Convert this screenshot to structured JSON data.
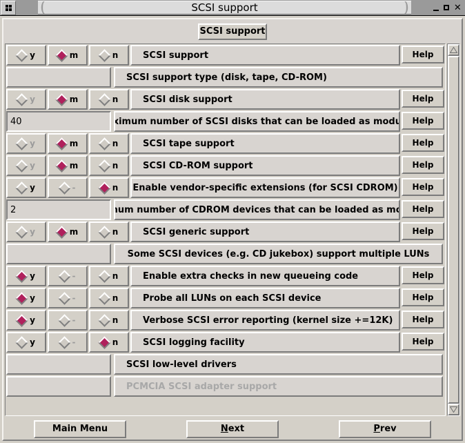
{
  "window": {
    "title": "SCSI support",
    "menu_icon": "window-menu-icon",
    "minimize_label": "minimize-icon",
    "maximize_label": "maximize-icon",
    "close_label": "close-icon"
  },
  "header": {
    "page_button": "SCSI support"
  },
  "colors": {
    "face": "#d4d0c8",
    "selected_radio": "#a01050",
    "disabled_text": "#a8a8a8"
  },
  "help_label": "Help",
  "radio_options": {
    "yes": "y",
    "module": "m",
    "no": "n",
    "na": "-"
  },
  "rows": [
    {
      "type": "radio",
      "y": "y",
      "m": "m",
      "n": "n",
      "selected": "m",
      "y_enabled": true,
      "m_enabled": true,
      "n_enabled": true,
      "label": "SCSI support",
      "align": "left",
      "help": "Help"
    },
    {
      "type": "header",
      "label": "SCSI support type (disk, tape, CD-ROM)",
      "align": "left",
      "help": null
    },
    {
      "type": "radio",
      "y": "y",
      "m": "m",
      "n": "n",
      "selected": "m",
      "y_enabled": false,
      "m_enabled": true,
      "n_enabled": true,
      "label": "SCSI disk support",
      "align": "left",
      "help": "Help"
    },
    {
      "type": "entry",
      "value": "40",
      "label": "Maximum number of SCSI disks that can be loaded as modules",
      "align": "center",
      "help": "Help"
    },
    {
      "type": "radio",
      "y": "y",
      "m": "m",
      "n": "n",
      "selected": "m",
      "y_enabled": false,
      "m_enabled": true,
      "n_enabled": true,
      "label": "SCSI tape support",
      "align": "left",
      "help": "Help"
    },
    {
      "type": "radio",
      "y": "y",
      "m": "m",
      "n": "n",
      "selected": "m",
      "y_enabled": false,
      "m_enabled": true,
      "n_enabled": true,
      "label": "SCSI CD-ROM support",
      "align": "left",
      "help": "Help"
    },
    {
      "type": "radio",
      "y": "y",
      "m": "-",
      "n": "n",
      "selected": "n",
      "y_enabled": true,
      "m_enabled": false,
      "n_enabled": true,
      "label": "Enable vendor-specific extensions (for SCSI CDROM)",
      "align": "center",
      "help": "Help"
    },
    {
      "type": "entry",
      "value": "2",
      "label": "Maximum number of CDROM devices that can be loaded as modules",
      "align": "center",
      "help": "Help"
    },
    {
      "type": "radio",
      "y": "y",
      "m": "m",
      "n": "n",
      "selected": "m",
      "y_enabled": false,
      "m_enabled": true,
      "n_enabled": true,
      "label": "SCSI generic support",
      "align": "left",
      "help": "Help"
    },
    {
      "type": "header",
      "label": "Some SCSI devices (e.g. CD jukebox) support multiple LUNs",
      "align": "center",
      "help": null
    },
    {
      "type": "radio",
      "y": "y",
      "m": "-",
      "n": "n",
      "selected": "y",
      "y_enabled": true,
      "m_enabled": false,
      "n_enabled": true,
      "label": "Enable extra checks in new queueing code",
      "align": "left",
      "help": "Help"
    },
    {
      "type": "radio",
      "y": "y",
      "m": "-",
      "n": "n",
      "selected": "y",
      "y_enabled": true,
      "m_enabled": false,
      "n_enabled": true,
      "label": "Probe all LUNs on each SCSI device",
      "align": "left",
      "help": "Help"
    },
    {
      "type": "radio",
      "y": "y",
      "m": "-",
      "n": "n",
      "selected": "y",
      "y_enabled": true,
      "m_enabled": false,
      "n_enabled": true,
      "label": "Verbose SCSI error reporting (kernel size +=12K)",
      "align": "left",
      "help": "Help"
    },
    {
      "type": "radio",
      "y": "y",
      "m": "-",
      "n": "n",
      "selected": "n",
      "y_enabled": true,
      "m_enabled": false,
      "n_enabled": true,
      "label": "SCSI logging facility",
      "align": "left",
      "help": "Help"
    },
    {
      "type": "menu",
      "label": "SCSI low-level drivers",
      "align": "left",
      "help": null,
      "disabled": false
    },
    {
      "type": "menu",
      "label": "PCMCIA SCSI adapter support",
      "align": "left",
      "help": null,
      "disabled": true
    }
  ],
  "scrollbar": {
    "up": "scroll-up-arrow",
    "down": "scroll-down-arrow",
    "thumb": "scroll-thumb"
  },
  "footer": {
    "main_menu": "Main Menu",
    "next_pre": "",
    "next_accel": "N",
    "next_post": "ext",
    "prev_pre": "",
    "prev_accel": "P",
    "prev_post": "rev"
  }
}
